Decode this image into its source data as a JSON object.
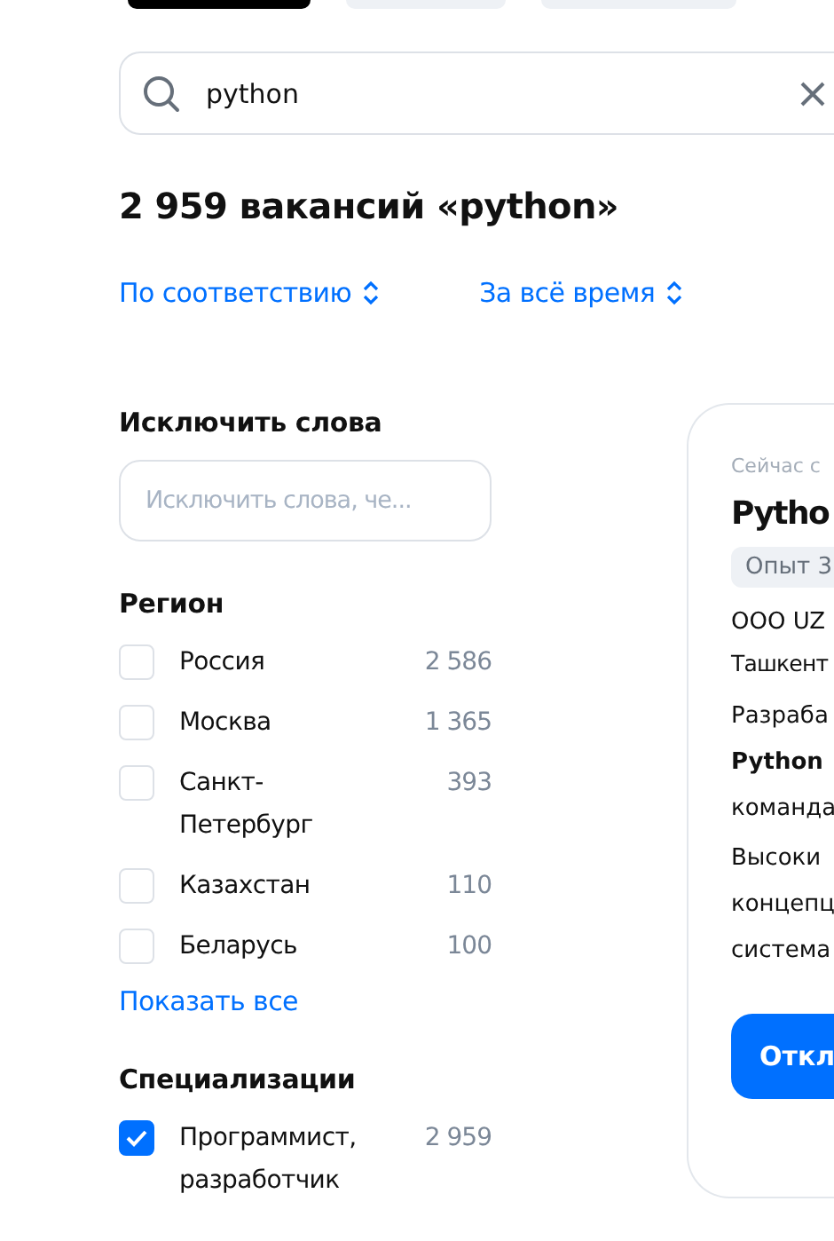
{
  "top_tabs": [
    {
      "selected": true
    },
    {
      "selected": false
    },
    {
      "selected": false
    }
  ],
  "search": {
    "value": "python"
  },
  "results_title": "2 959 вакансий «python»",
  "sort": [
    {
      "label": "По соответствию"
    },
    {
      "label": "За всё время"
    }
  ],
  "exclude": {
    "title": "Исключить слова",
    "placeholder": "Исключить слова, че..."
  },
  "filters": [
    {
      "title": "Регион",
      "items": [
        {
          "label": "Россия",
          "count": "2 586",
          "checked": false
        },
        {
          "label": "Москва",
          "count": "1 365",
          "checked": false
        },
        {
          "label": "Санкт-Петербург",
          "count": "393",
          "checked": false
        },
        {
          "label": "Казахстан",
          "count": "110",
          "checked": false
        },
        {
          "label": "Беларусь",
          "count": "100",
          "checked": false
        }
      ],
      "show_all": "Показать все"
    },
    {
      "title": "Специализации",
      "items": [
        {
          "label": "Программист, разработчик",
          "count": "2 959",
          "checked": true
        }
      ]
    }
  ],
  "card": {
    "caption": "Сейчас с",
    "title": "Pytho",
    "tag": "Опыт 3",
    "company": "ООО UZ",
    "city": "Ташкент",
    "paragraphs": [
      "Разраба\n**Python**\nкоманда",
      "Высоки\nконцепц\nсистема"
    ],
    "button": "Откл"
  }
}
